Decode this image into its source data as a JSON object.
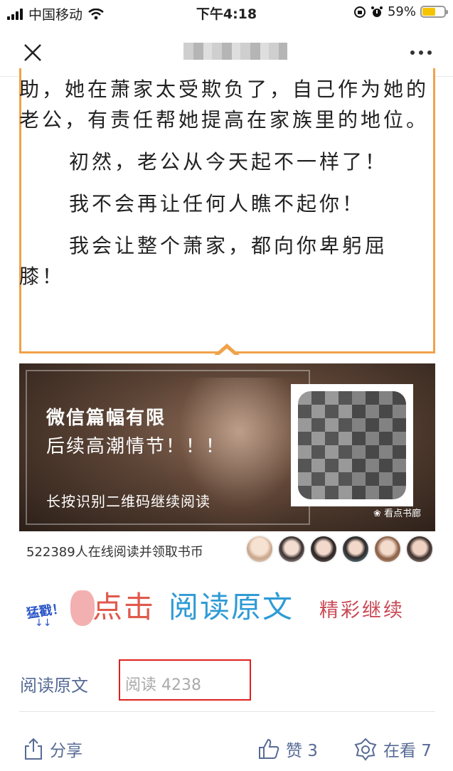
{
  "status_bar": {
    "carrier": "中国移动",
    "time": "下午4:18",
    "battery_percent": "59%",
    "battery_level": 0.59
  },
  "nav": {
    "close_icon": "close-icon",
    "more_icon": "more-icon"
  },
  "article": {
    "paragraph1": "助，她在萧家太受欺负了，自己作为她的老公，有责任帮她提高在家族里的地位。",
    "paragraph2": "初然，老公从今天起不一样了！",
    "paragraph3": "我不会再让任何人瞧不起你！",
    "paragraph4": "我会让整个萧家，都向你卑躬屈膝！",
    "accent_color": "#f0a24a"
  },
  "banner": {
    "title": "微信篇幅有限",
    "subtitle": "后续高潮情节！！！",
    "hint": "长按识别二维码继续阅读",
    "qr_caption": "看点书廊"
  },
  "online": {
    "text": "522389人在线阅读并领取书币"
  },
  "cta": {
    "small": "猛戳！",
    "arrows": "↓↓",
    "click": "点击",
    "read_original": "阅读原文",
    "continue": "精彩继续"
  },
  "footer": {
    "read_original_link": "阅读原文",
    "read_count": "阅读 4238"
  },
  "actions": {
    "share": "分享",
    "like": "赞 3",
    "wow": "在看 7",
    "link_color": "#576b95"
  }
}
